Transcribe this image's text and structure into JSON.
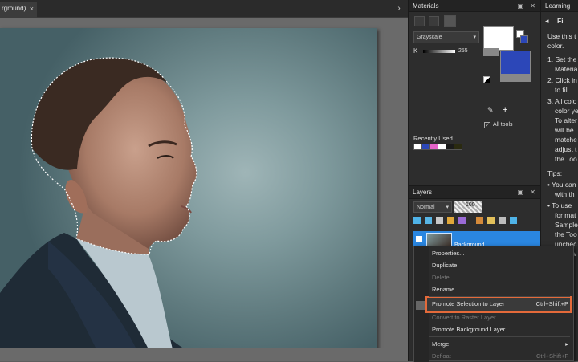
{
  "document": {
    "tab_label": "rground)",
    "tab_close": "×",
    "scroll_arrow": "›"
  },
  "materials": {
    "title": "Materials",
    "window_buttons": "▣ ✕",
    "mode": "Grayscale",
    "channel_label": "K",
    "channel_value": "255",
    "recently_used_label": "Recently Used",
    "all_tools_label": "All tools",
    "recent_colors": [
      "#ffffff",
      "#2c47b8",
      "#e563c8",
      "#ffffff",
      "#1a1a1a",
      "#2a2a10"
    ],
    "fg_color": "#ffffff",
    "bg_color": "#2c47b8"
  },
  "layers": {
    "title": "Layers",
    "window_buttons": "▣ ✕",
    "blend_mode": "Normal",
    "opacity": "100",
    "layer_name": "Background"
  },
  "learning": {
    "title": "Learning",
    "heading": "Fi",
    "lines": [
      "Use this t",
      "color.",
      "1. Set the",
      "Materia",
      "2. Click in",
      "to fill.",
      "3. All colo",
      "color ye",
      "To alter",
      "will be",
      "matche",
      "adjust t",
      "the Too",
      "Tips:",
      "• You can",
      "with th",
      "• To use",
      "for mat",
      "Sample",
      "the Too",
      "unchec",
      "layer w"
    ]
  },
  "context_menu": {
    "items": [
      {
        "label": "Properties...",
        "shortcut": "",
        "disabled": false
      },
      {
        "label": "Duplicate",
        "shortcut": "",
        "disabled": false
      },
      {
        "label": "Delete",
        "shortcut": "",
        "disabled": true
      },
      {
        "label": "Rename...",
        "shortcut": "",
        "disabled": false
      },
      {
        "label": "Promote Selection to Layer",
        "shortcut": "Ctrl+Shift+P",
        "disabled": false
      },
      {
        "label": "Convert to Raster Layer",
        "shortcut": "",
        "disabled": true
      },
      {
        "label": "Promote Background Layer",
        "shortcut": "",
        "disabled": false
      },
      {
        "label": "Merge",
        "shortcut": "▸",
        "disabled": false
      },
      {
        "label": "Defloat",
        "shortcut": "Ctrl+Shift+F",
        "disabled": true
      }
    ]
  }
}
